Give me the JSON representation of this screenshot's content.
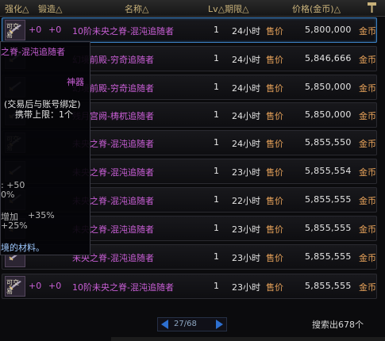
{
  "header": {
    "cols": [
      "强化△",
      "锻造△",
      "名称△",
      "Lv△期限△",
      "价格(金币)△"
    ]
  },
  "rows": [
    {
      "icon_tag": "可交易",
      "str": "+0",
      "forge": "+0",
      "name": "10阶未央之脊-混沌追随者",
      "lv": "1",
      "limit": "24小时",
      "label": "售价",
      "price": "5,800,000",
      "currency": "金币",
      "selected": true
    },
    {
      "icon_tag": "",
      "str": "",
      "forge": "",
      "name": "幻境前殿-穷奇追随者",
      "lv": "1",
      "limit": "24小时",
      "label": "售价",
      "price": "5,846,666",
      "currency": "金币",
      "selected": false
    },
    {
      "icon_tag": "",
      "str": "",
      "forge": "",
      "name": "幻境前殿-穷奇追随者",
      "lv": "1",
      "limit": "24小时",
      "label": "售价",
      "price": "5,850,000",
      "currency": "金币",
      "selected": false
    },
    {
      "icon_tag": "",
      "str": "",
      "forge": "",
      "name": "残月宫阙-梼杌追随者",
      "lv": "1",
      "limit": "24小时",
      "label": "售价",
      "price": "5,850,000",
      "currency": "金币",
      "selected": false
    },
    {
      "icon_tag": "可交易",
      "str": "",
      "forge": "",
      "name": "未央之脊-混沌追随者",
      "lv": "1",
      "limit": "24小时",
      "label": "售价",
      "price": "5,855,550",
      "currency": "金币",
      "selected": false
    },
    {
      "icon_tag": "",
      "str": "",
      "forge": "",
      "name": "未央之脊-混沌追随者",
      "lv": "1",
      "limit": "23小时",
      "label": "售价",
      "price": "5,855,554",
      "currency": "金币",
      "selected": false
    },
    {
      "icon_tag": "",
      "str": "",
      "forge": "",
      "name": "未央之脊-混沌追随者",
      "lv": "1",
      "limit": "22小时",
      "label": "售价",
      "price": "5,855,555",
      "currency": "金币",
      "selected": false
    },
    {
      "icon_tag": "",
      "str": "",
      "forge": "",
      "name": "未央之脊-混沌追随者",
      "lv": "1",
      "limit": "23小时",
      "label": "售价",
      "price": "5,855,555",
      "currency": "金币",
      "selected": false
    },
    {
      "icon_tag": "",
      "str": "",
      "forge": "",
      "name": "未央之脊-混沌追随者",
      "lv": "1",
      "limit": "23小时",
      "label": "售价",
      "price": "5,855,555",
      "currency": "金币",
      "selected": false
    },
    {
      "icon_tag": "可交易",
      "str": "+0",
      "forge": "+0",
      "name": "10阶未央之脊-混沌追随者",
      "lv": "1",
      "limit": "23小时",
      "label": "售价",
      "price": "5,855,555",
      "currency": "金币",
      "selected": false
    }
  ],
  "tooltip": {
    "title": "之脊-混沌追随者",
    "type": "神器",
    "bind": "(交易后与账号绑定)",
    "carry": "携带上限：1个",
    "stat1": ": +50",
    "stat2": "0%",
    "stat3": "增加",
    "stat3b": "+35%",
    "stat4": "+25%",
    "material": "境的材料。"
  },
  "pager": {
    "text": "27/68"
  },
  "result_count": "搜索出678个",
  "colors": {
    "accent": "#3b7fc0",
    "name": "#c95fd6",
    "gold": "#e8a35a"
  }
}
